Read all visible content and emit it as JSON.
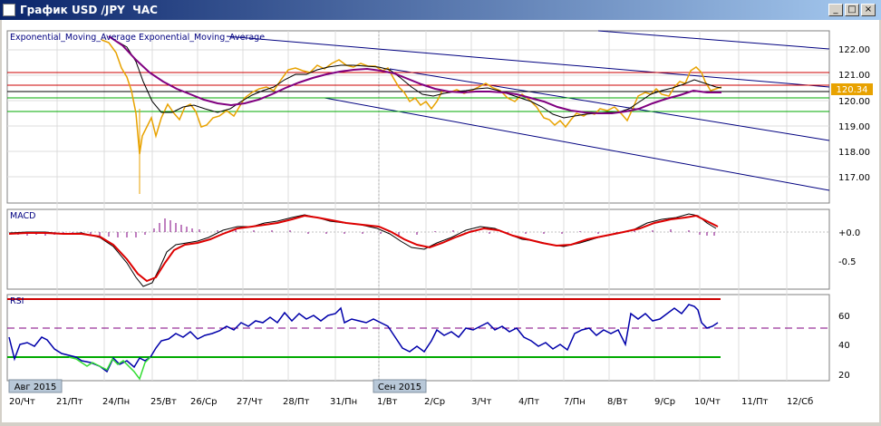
{
  "window": {
    "title": "График USD /JPY  ЧАС",
    "buttons": {
      "minimize": "_",
      "maximize": "□",
      "close": "×"
    }
  },
  "price_panel": {
    "label": "Exponential_Moving_Average Exponential_Moving_Average",
    "ticks": [
      "122.00",
      "121.00",
      "120.00",
      "119.00",
      "118.00",
      "117.00"
    ],
    "current_price": "120.34"
  },
  "macd_panel": {
    "label": "MACD",
    "ticks": [
      "+0.0",
      "-0.5"
    ]
  },
  "rsi_panel": {
    "label": "RSI",
    "ticks": [
      "60",
      "40",
      "20"
    ]
  },
  "x_axis": {
    "month_flags": [
      "Авг 2015",
      "Сен 2015"
    ],
    "labels": [
      "20/Чт",
      "21/Пт",
      "24/Пн",
      "25/Вт",
      "26/Ср",
      "27/Чт",
      "28/Пт",
      "31/Пн",
      "1/Вт",
      "2/Ср",
      "3/Чт",
      "4/Пт",
      "7/Пн",
      "8/Вт",
      "9/Ср",
      "10/Чт",
      "11/Пт",
      "12/Сб"
    ]
  },
  "colors": {
    "price_line": "#e8a200",
    "ema_fast": "#000000",
    "ema_slow": "#800080",
    "resistance": "#cc0000",
    "support": "#00aa00",
    "trend": "#000080",
    "rsi_line": "#0000aa",
    "macd_signal": "#dd0000",
    "macd_hist": "#800080"
  }
}
